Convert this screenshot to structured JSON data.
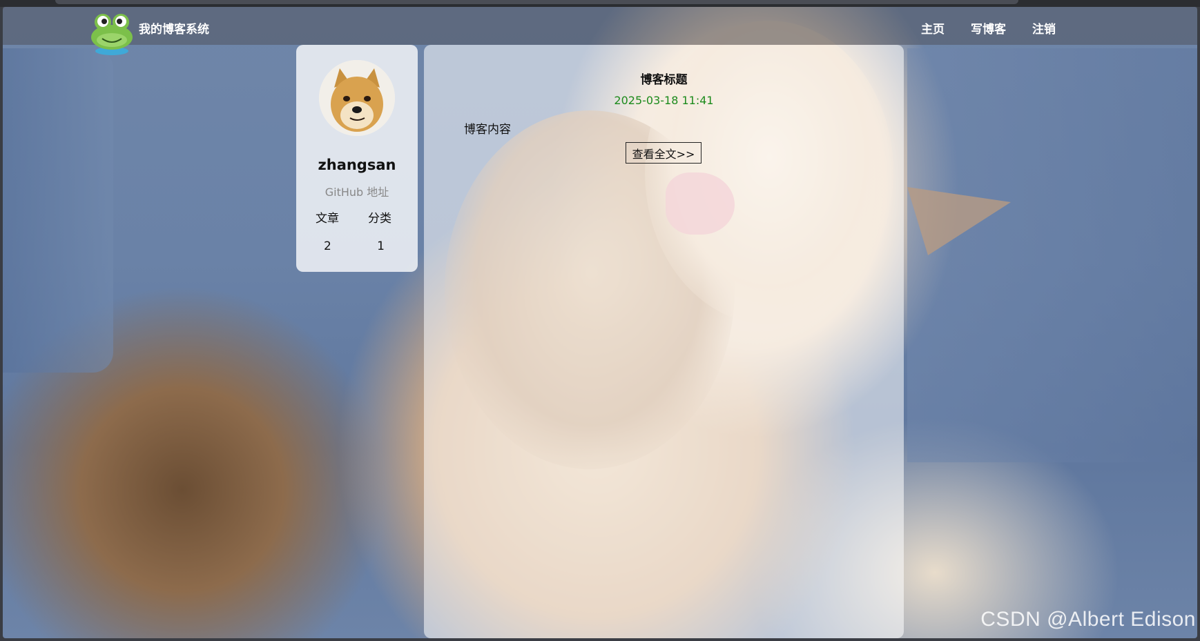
{
  "nav": {
    "brand": "我的博客系统",
    "links": [
      "主页",
      "写博客",
      "注销"
    ]
  },
  "profile": {
    "username": "zhangsan",
    "github_label": "GitHub 地址",
    "stats": {
      "labels": [
        "文章",
        "分类"
      ],
      "values": [
        "2",
        "1"
      ]
    }
  },
  "post": {
    "title": "博客标题",
    "date": "2025-03-18 11:41",
    "content": "博客内容",
    "read_more": "查看全文>>"
  },
  "watermark": "CSDN @Albert Edison",
  "colors": {
    "date": "#1b8a1b",
    "nav_text": "#ffffff"
  }
}
